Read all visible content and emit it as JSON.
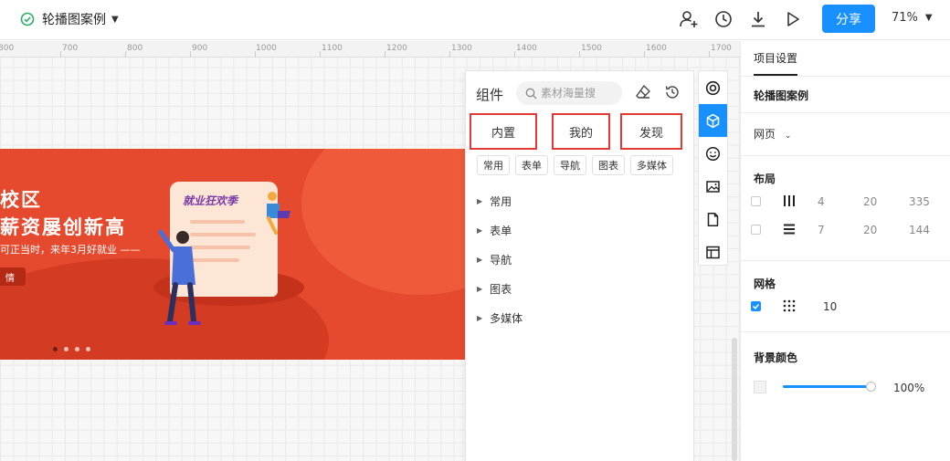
{
  "header": {
    "title": "轮播图案例",
    "share_label": "分享",
    "zoom": "71%"
  },
  "ruler": {
    "labels": [
      "800",
      "700",
      "800",
      "900",
      "1000",
      "1100",
      "1200",
      "1300",
      "1400",
      "1500",
      "1600",
      "1700"
    ]
  },
  "banner": {
    "line1": "校区",
    "line2": "薪资屡创新高",
    "line3": "可正当时，来年3月好就业 ——",
    "button": "情",
    "scroll_title": "就业狂欢季"
  },
  "components": {
    "title": "组件",
    "search_placeholder": "素材海量搜",
    "tabs": [
      "内置",
      "我的",
      "发现"
    ],
    "chips": [
      "常用",
      "表单",
      "导航",
      "图表",
      "多媒体"
    ],
    "categories": [
      "常用",
      "表单",
      "导航",
      "图表",
      "多媒体"
    ]
  },
  "settings": {
    "tab": "项目设置",
    "project_name": "轮播图案例",
    "page_type": "网页",
    "layout_title": "布局",
    "layout_rows": [
      {
        "a": "4",
        "b": "20",
        "c": "335"
      },
      {
        "a": "7",
        "b": "20",
        "c": "144"
      }
    ],
    "grid_title": "网格",
    "grid_value": "10",
    "bg_title": "背景颜色",
    "bg_opacity": "100%"
  },
  "colors": {
    "accent": "#1890ff",
    "banner": "#e64a2e",
    "highlight_border": "#e53935"
  }
}
